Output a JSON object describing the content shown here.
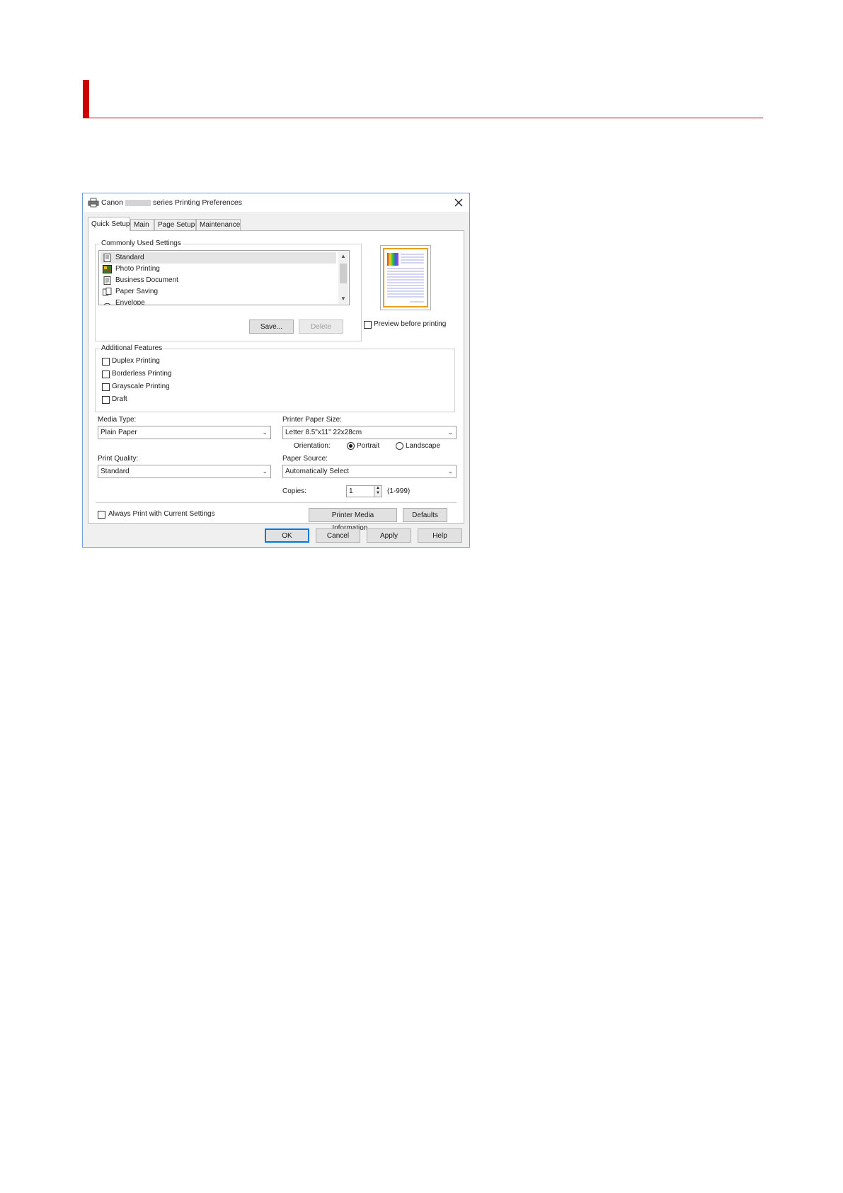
{
  "dialog": {
    "title_prefix": "Canon",
    "title_suffix": "series Printing Preferences",
    "tabs": [
      {
        "label": "Quick Setup",
        "active": true
      },
      {
        "label": "Main",
        "active": false
      },
      {
        "label": "Page Setup",
        "active": false
      },
      {
        "label": "Maintenance",
        "active": false
      }
    ]
  },
  "commonly_used": {
    "label": "Commonly Used Settings",
    "items": [
      {
        "label": "Standard",
        "icon": "standard-doc-icon"
      },
      {
        "label": "Photo Printing",
        "icon": "photo-icon"
      },
      {
        "label": "Business Document",
        "icon": "business-doc-icon"
      },
      {
        "label": "Paper Saving",
        "icon": "paper-saving-icon"
      },
      {
        "label": "Envelope",
        "icon": "envelope-icon"
      }
    ],
    "save_label": "Save...",
    "delete_label": "Delete"
  },
  "preview": {
    "checkbox_label": "Preview before printing"
  },
  "additional_features": {
    "label": "Additional Features",
    "items": [
      "Duplex Printing",
      "Borderless Printing",
      "Grayscale Printing",
      "Draft"
    ]
  },
  "media_type": {
    "label": "Media Type:",
    "value": "Plain Paper"
  },
  "print_quality": {
    "label": "Print Quality:",
    "value": "Standard"
  },
  "paper_size": {
    "label": "Printer Paper Size:",
    "value": "Letter 8.5\"x11\" 22x28cm"
  },
  "orientation": {
    "label": "Orientation:",
    "portrait": "Portrait",
    "landscape": "Landscape"
  },
  "paper_source": {
    "label": "Paper Source:",
    "value": "Automatically Select"
  },
  "copies": {
    "label": "Copies:",
    "value": "1",
    "range": "(1-999)"
  },
  "bottom": {
    "always_print_label": "Always Print with Current Settings",
    "media_info_label": "Printer Media Information...",
    "defaults_label": "Defaults"
  },
  "footer": {
    "ok": "OK",
    "cancel": "Cancel",
    "apply": "Apply",
    "help": "Help"
  },
  "colors": {
    "accent": "#cc0000",
    "window_border": "#6f9fd8",
    "focus": "#0078d7"
  }
}
